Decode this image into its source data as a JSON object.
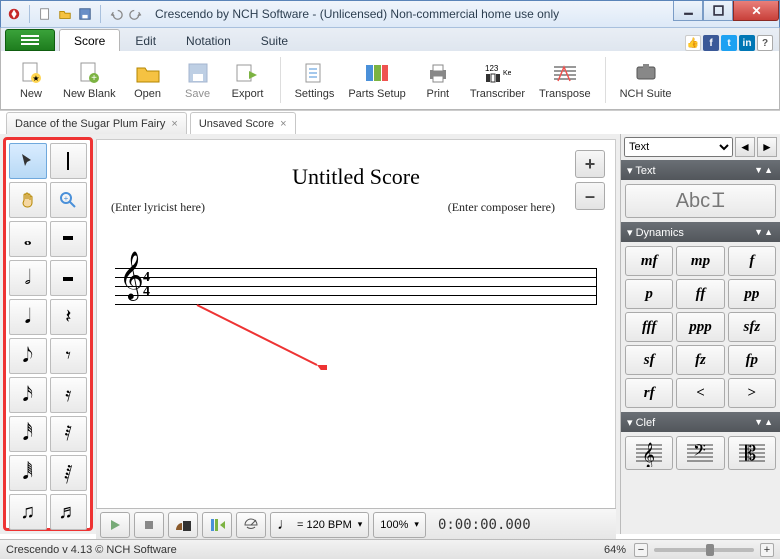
{
  "window": {
    "title": "Crescendo by NCH Software - (Unlicensed) Non-commercial home use only"
  },
  "ribbon": {
    "tabs": [
      "Score",
      "Edit",
      "Notation",
      "Suite"
    ],
    "active": 0,
    "buttons": {
      "new": "New",
      "newblank": "New Blank",
      "open": "Open",
      "save": "Save",
      "export": "Export",
      "settings": "Settings",
      "parts": "Parts Setup",
      "print": "Print",
      "transcriber": "Transcriber",
      "transpose": "Transpose",
      "nch": "NCH Suite"
    }
  },
  "doctabs": [
    {
      "label": "Dance of the Sugar Plum Fairy",
      "active": false
    },
    {
      "label": "Unsaved Score",
      "active": true
    }
  ],
  "score": {
    "title": "Untitled Score",
    "lyricist": "(Enter lyricist here)",
    "composer": "(Enter composer here)"
  },
  "zoom": {
    "plus": "+",
    "minus": "–"
  },
  "rightpanel": {
    "selector": "Text",
    "sections": {
      "text": "Text",
      "dynamics": "Dynamics",
      "clef": "Clef"
    },
    "text_sample": "Abc",
    "dynamics": [
      "mf",
      "mp",
      "f",
      "p",
      "ff",
      "pp",
      "fff",
      "ppp",
      "sfz",
      "sf",
      "fz",
      "fp",
      "rf",
      "<",
      ">"
    ]
  },
  "playback": {
    "tempo_label": "= 120 BPM",
    "zoom_pct": "100%",
    "time": "0:00:00.000"
  },
  "status": {
    "version": "Crescendo v 4.13 © NCH Software",
    "zoom": "64%"
  },
  "palette_glyphs": [
    "↖",
    "|",
    "✋",
    "🔍",
    "𝅝",
    "▬",
    "𝅗𝅥",
    "▪",
    "𝅘𝅥",
    "▪",
    "𝅘𝅥𝅮",
    "𝅮",
    "𝅘𝅥𝅯",
    "𝅘𝅥𝅯",
    "𝅘𝅥𝅰",
    "𝅘𝅥𝅰",
    "𝅘𝅥𝅱",
    "𝅘𝅥𝅱",
    "♫",
    "♬"
  ]
}
